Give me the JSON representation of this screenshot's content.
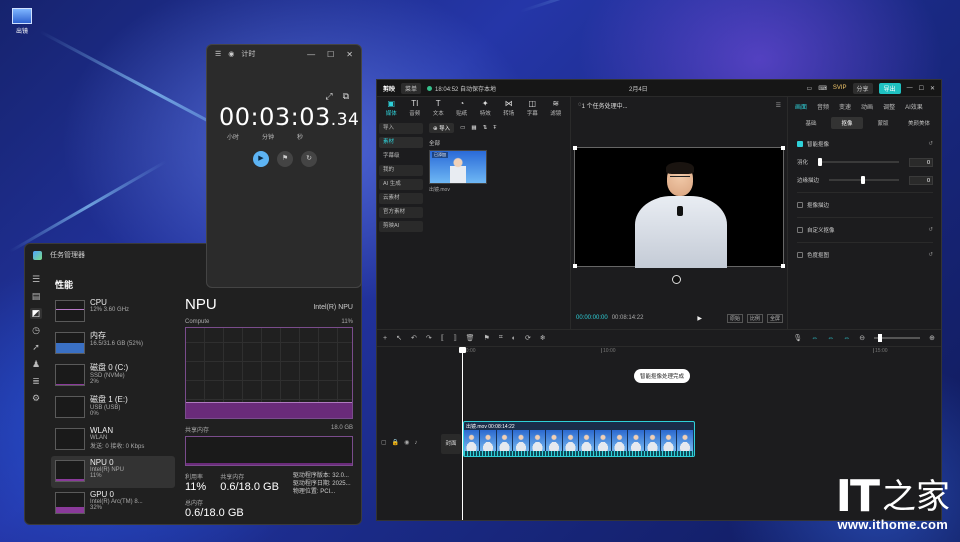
{
  "desktop": {
    "icon_label": "出镜"
  },
  "task_manager": {
    "title": "任务管理器",
    "section": "性能",
    "items": [
      {
        "name": "CPU",
        "detail": "12% 3.60 GHz",
        "fill": 0.12,
        "style": "wave"
      },
      {
        "name": "内存",
        "detail": "16.5/31.6 GB (52%)",
        "fill": 0.52,
        "style": "blue"
      },
      {
        "name": "磁盘 0 (C:)",
        "detail": "SSD (NVMe)",
        "detail2": "2%",
        "fill": 0.02,
        "style": "plain"
      },
      {
        "name": "磁盘 1 (E:)",
        "detail": "USB (USB)",
        "detail2": "0%",
        "fill": 0.0,
        "style": "plain"
      },
      {
        "name": "WLAN",
        "detail": "WLAN",
        "detail2": "发送: 0 接收: 0 Kbps",
        "fill": 0.0,
        "style": "plain"
      },
      {
        "name": "NPU 0",
        "detail": "Intel(R) NPU",
        "detail2": "11%",
        "fill": 0.11,
        "style": "purple"
      },
      {
        "name": "GPU 0",
        "detail": "Intel(R) Arc(TM) 8...",
        "detail2": "32%",
        "fill": 0.32,
        "style": "purple"
      }
    ],
    "npu": {
      "title": "NPU",
      "device": "Intel(R) NPU",
      "graph_label": "Compute",
      "graph_max": "11%",
      "mem_label": "共享内存",
      "mem_max": "18.0 GB",
      "utilization_label": "利用率",
      "utilization": "11%",
      "shared_label": "共享内存",
      "shared": "0.6/18.0 GB",
      "driver_version_label": "驱动程序版本:",
      "driver_version": "32.0...",
      "driver_date_label": "驱动程序日期:",
      "driver_date": "2025...",
      "location_label": "物理位置:",
      "location": "PCI...",
      "npu_memory_label": "总内存",
      "npu_memory": "0.6/18.0 GB"
    }
  },
  "clock": {
    "title": "计时",
    "time_main": "00:03:03",
    "time_frac": ".34",
    "units": [
      "小时",
      "分钟",
      "秒"
    ]
  },
  "editor": {
    "brand": "剪映",
    "menu": "菜单",
    "save_status": "18:04:52 自动保存本地",
    "project": "2月4日",
    "svip": "SVIP",
    "share": "分享",
    "export": "导出",
    "tools": [
      {
        "icon": "▣",
        "label": "媒体"
      },
      {
        "icon": "TI",
        "label": "音频"
      },
      {
        "icon": "T",
        "label": "文本"
      },
      {
        "icon": "◔",
        "label": "贴纸"
      },
      {
        "icon": "✦",
        "label": "特效"
      },
      {
        "icon": "⋈",
        "label": "转场"
      },
      {
        "icon": "◫",
        "label": "字幕"
      },
      {
        "icon": "≋",
        "label": "滤镜"
      }
    ],
    "media_side": [
      "导入",
      "素材",
      "字幕级",
      "我的",
      "AI 生成",
      "云素材",
      "官方素材",
      "剪映AI"
    ],
    "import_btn": "导入",
    "all_label": "全部",
    "clip_file": "出镜.mov",
    "thumb_tag": "已添加",
    "player_title": "1 个任务处理中...",
    "time_current": "00:00:00:00",
    "time_total": "00:08:14:22",
    "player_btns": [
      "原始",
      "比例",
      "全屏"
    ],
    "prop_tabs": [
      "画面",
      "音频",
      "变速",
      "动画",
      "调整",
      "AI效果"
    ],
    "prop_sub": [
      "基础",
      "抠像",
      "蒙版",
      "美颜美体"
    ],
    "cutout_label": "智能抠像",
    "stroke_label": "羽化",
    "stroke_value": "0",
    "edge_label": "边缘描边",
    "edge_value": "0",
    "fg_label": "抠像描边",
    "custom_label": "自定义抠像",
    "color_label": "色度抠图",
    "tip": "智能抠像处理完成",
    "cover": "封面",
    "clip_label": "出镜.mov  00:08:14:22",
    "ruler": [
      "00:00",
      "10:00",
      "15:00"
    ]
  },
  "watermark": {
    "brand": "IT",
    "zh": "之家",
    "url": "www.ithome.com"
  }
}
